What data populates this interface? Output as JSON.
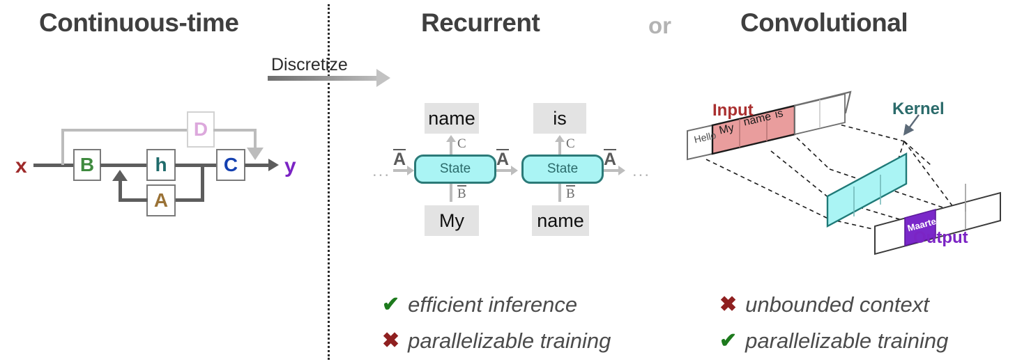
{
  "headings": {
    "left": "Continuous-time",
    "middle": "Recurrent",
    "conjunction": "or",
    "right": "Convolutional"
  },
  "transition": {
    "label": "Discretize",
    "arrow_icon": "arrow-right-gradient"
  },
  "continuous_diagram": {
    "input_label": "x",
    "output_label": "y",
    "input_color": "#9e2a2a",
    "output_color": "#7b24c4",
    "boxes": [
      {
        "id": "B",
        "label": "B",
        "color": "#3f8a3f"
      },
      {
        "id": "h",
        "label": "h",
        "color": "#1f6b6b"
      },
      {
        "id": "C",
        "label": "C",
        "color": "#1440b0"
      },
      {
        "id": "A",
        "label": "A",
        "color": "#9a7236"
      },
      {
        "id": "D",
        "label": "D",
        "color": "#dca8dc"
      }
    ]
  },
  "recurrent": {
    "cells": [
      {
        "output_token": "name",
        "input_token": "My",
        "state_label": "State",
        "out_matrix": "C",
        "in_matrix": "B",
        "transition_matrix": "A"
      },
      {
        "output_token": "is",
        "input_token": "name",
        "state_label": "State",
        "out_matrix": "C",
        "in_matrix": "B",
        "transition_matrix": "A"
      }
    ],
    "left_ellipsis": "...",
    "right_ellipsis": "...",
    "trailing_matrix": "A"
  },
  "convolution": {
    "input_label": "Input",
    "input_color": "#a92f2f",
    "kernel_label": "Kernel",
    "kernel_color": "#2b6b6b",
    "output_label": "Output",
    "output_color": "#7b24c4",
    "input_cells": [
      {
        "text": "Hello",
        "filled": false
      },
      {
        "text": "My",
        "filled": true
      },
      {
        "text": "name",
        "filled": true
      },
      {
        "text": "is",
        "filled": true
      },
      {
        "text": "",
        "filled": false
      },
      {
        "text": "",
        "filled": false
      }
    ],
    "input_fill": "#e99d9d",
    "kernel_cells": 3,
    "kernel_fill": "#aaf4f4",
    "output_cells": [
      {
        "text": "",
        "filled": false
      },
      {
        "text": "Maarten",
        "filled": true
      },
      {
        "text": "",
        "filled": false
      },
      {
        "text": "",
        "filled": false
      }
    ],
    "output_fill": "#7a28c9"
  },
  "bullets": {
    "check_color": "#1d7a1d",
    "cross_color": "#8f2020",
    "check_glyph": "✔",
    "cross_glyph": "✖",
    "recurrent": [
      {
        "mark": "check",
        "text": "efficient inference"
      },
      {
        "mark": "cross",
        "text": "parallelizable training"
      }
    ],
    "convolutional": [
      {
        "mark": "cross",
        "text": "unbounded context"
      },
      {
        "mark": "check",
        "text": "parallelizable training"
      }
    ]
  }
}
